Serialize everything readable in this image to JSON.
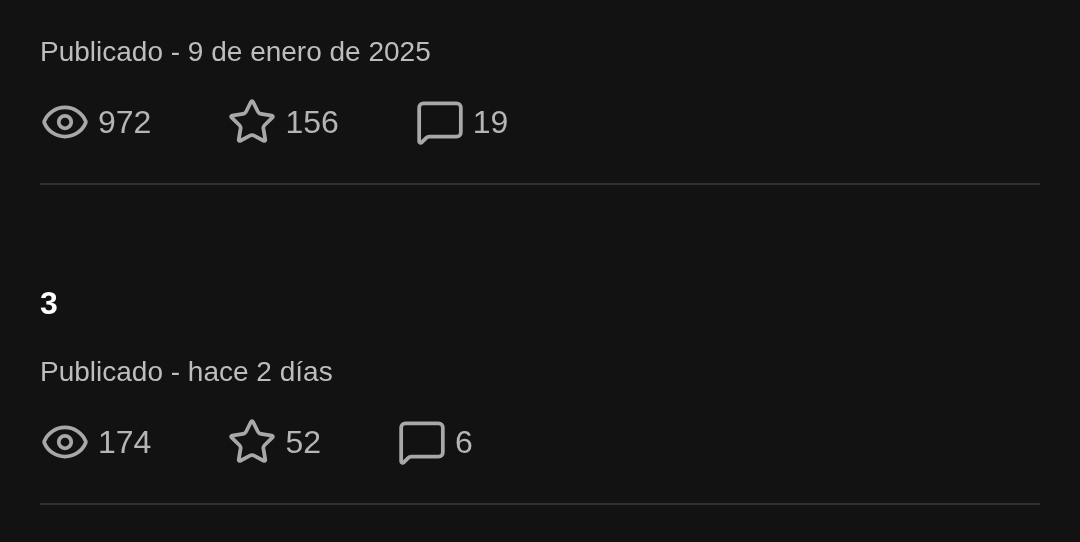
{
  "posts": [
    {
      "meta": "Publicado - 9 de enero de 2025",
      "views": "972",
      "stars": "156",
      "comments": "19"
    },
    {
      "title": "3",
      "meta": "Publicado - hace 2 días",
      "views": "174",
      "stars": "52",
      "comments": "6"
    }
  ]
}
